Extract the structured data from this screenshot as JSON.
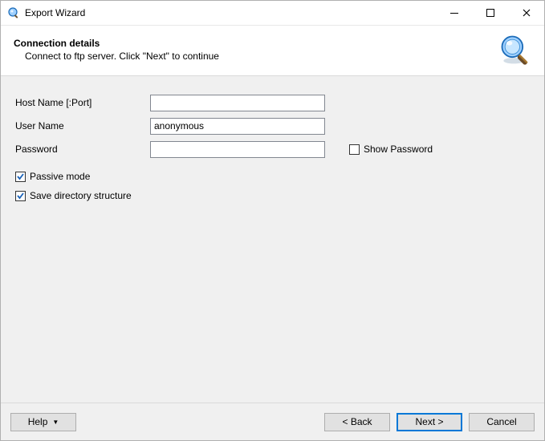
{
  "window": {
    "title": "Export Wizard"
  },
  "header": {
    "title": "Connection details",
    "subtitle": "Connect to ftp server. Click \"Next\" to continue"
  },
  "form": {
    "host": {
      "label": "Host Name [:Port]",
      "value": ""
    },
    "user": {
      "label": "User Name",
      "value": "anonymous"
    },
    "password": {
      "label": "Password",
      "value": ""
    },
    "show_password": {
      "label": "Show Password",
      "checked": false
    },
    "passive": {
      "label": "Passive mode",
      "checked": true
    },
    "save_structure": {
      "label": "Save directory structure",
      "checked": true
    }
  },
  "buttons": {
    "help": "Help",
    "back": "< Back",
    "next": "Next >",
    "cancel": "Cancel"
  }
}
